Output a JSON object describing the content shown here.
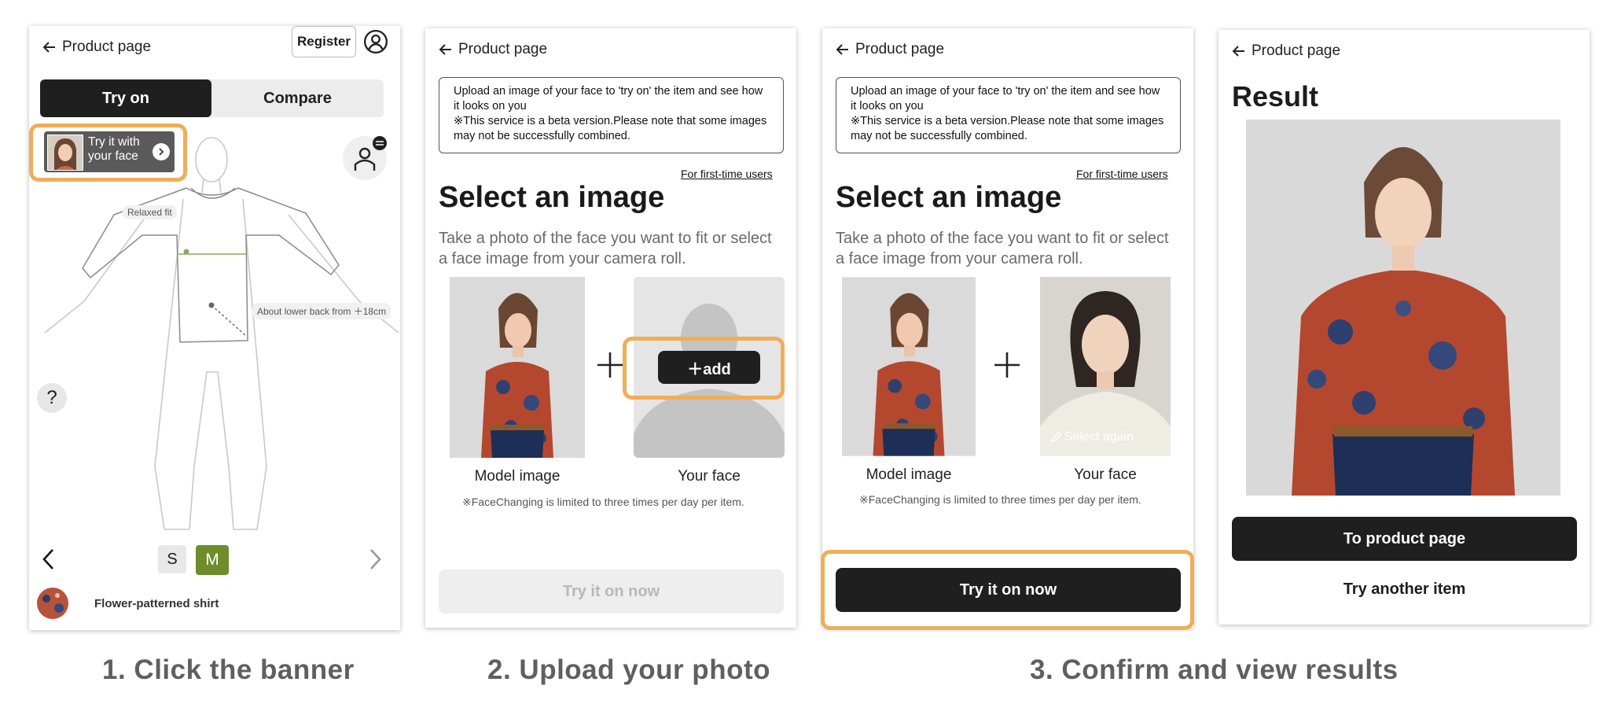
{
  "common": {
    "back_label": "Product page"
  },
  "step1": {
    "register_label": "Register",
    "tabs": [
      "Try on",
      "Compare"
    ],
    "banner_line1": "Try it with",
    "banner_line2": "your face",
    "annotation_fit": "Relaxed fit",
    "annotation_length": "About lower back from ＋18cm",
    "help_label": "?",
    "sizes": [
      "S",
      "M"
    ],
    "selected_size": "M",
    "product_name": "Flower-patterned shirt"
  },
  "upload": {
    "info_text": "Upload an image of your face to 'try on' the item and see how it looks on you\n※This service is a beta version.Please note that some images may not be successfully combined.",
    "first_time_link": "For first-time users",
    "heading": "Select an image",
    "subtext": "Take a photo of the face you want to fit or select a face image from your camera roll.",
    "model_caption": "Model image",
    "face_caption": "Your face",
    "limit_note": "※FaceChanging is limited to three times per day per item.",
    "add_label": "＋add",
    "select_again_label": "Select again",
    "try_now_label": "Try it on now"
  },
  "result": {
    "title": "Result",
    "to_product_label": "To product page",
    "try_another_label": "Try another item"
  },
  "captions": [
    "1. Click the banner",
    "2. Upload your photo",
    "3. Confirm and view results"
  ],
  "colors": {
    "accent": "#efae59",
    "dark": "#1f1f1f",
    "size_selected": "#6e8c2a",
    "disabled_bg": "#eeeeee"
  }
}
